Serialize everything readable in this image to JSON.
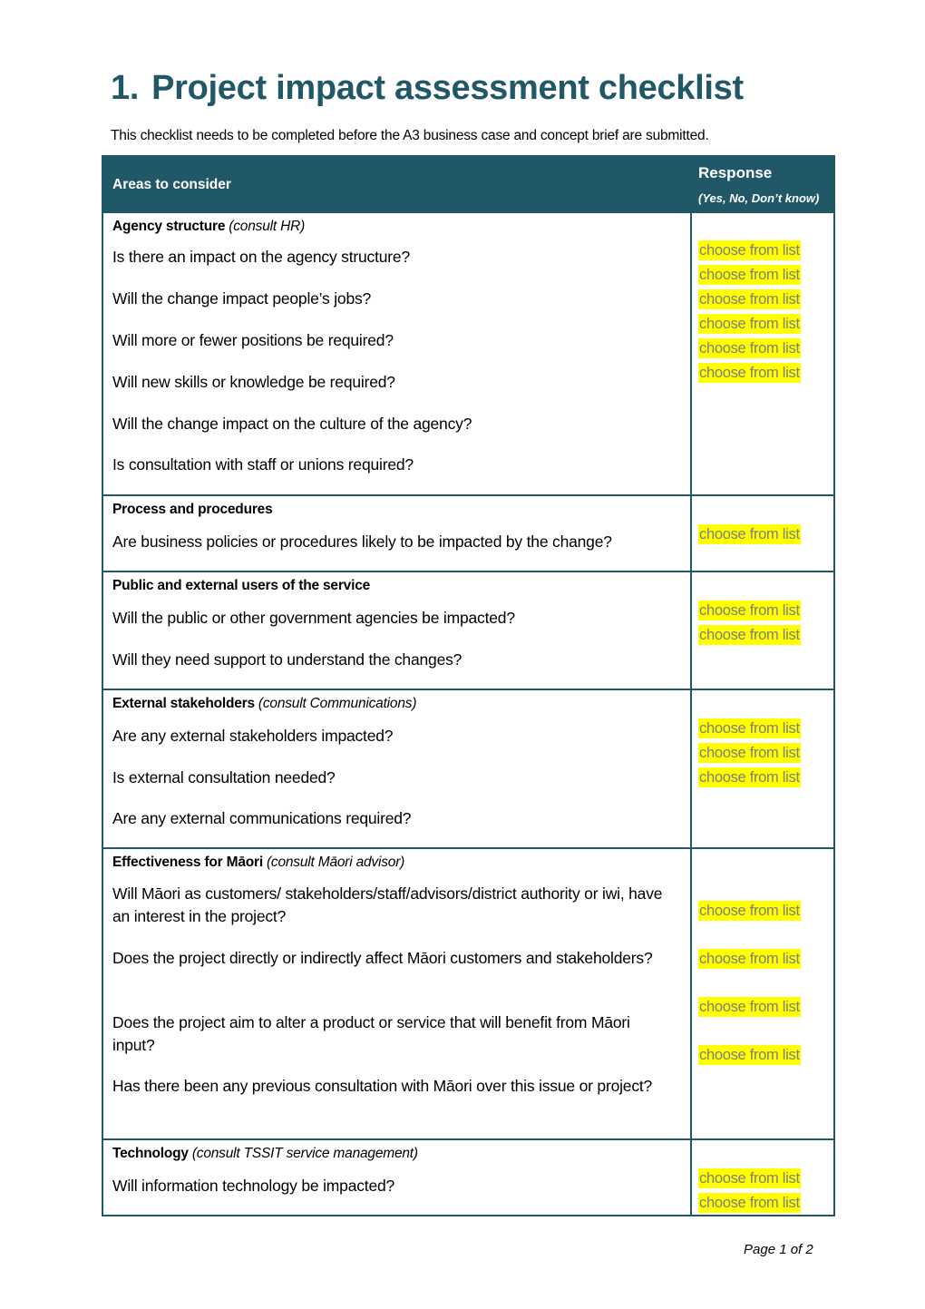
{
  "document": {
    "title_number": "1.",
    "title": "Project impact assessment checklist",
    "intro": "This checklist needs to be completed before the A3 business case and concept brief are submitted.",
    "footer": "Page 1 of 2"
  },
  "colors": {
    "brand": "#215868",
    "highlight": "#ffff00",
    "placeholder_text": "#7f7f7f"
  },
  "table": {
    "header": {
      "areas": "Areas to consider",
      "response": "Response",
      "response_sub": "(Yes, No, Don’t know)"
    },
    "sections": [
      {
        "title": "Agency structure",
        "consult": "(consult HR)",
        "questions": [
          "Is there an impact on the agency structure?",
          "Will the change impact people’s jobs?",
          "Will more or fewer positions be required?",
          "Will new skills or knowledge be required?",
          "Will the change impact on the culture of the agency?",
          "Is consultation with staff or unions required?"
        ],
        "responses": [
          "choose from list",
          "choose from list",
          "choose from list",
          "choose from list",
          "choose from list",
          "choose from list"
        ]
      },
      {
        "title": "Process and procedures",
        "consult": "",
        "questions": [
          "Are business policies or procedures likely to be impacted by the change?"
        ],
        "responses": [
          "choose from list"
        ]
      },
      {
        "title": "Public and external users of the service",
        "consult": "",
        "questions": [
          "Will the public or other government agencies be impacted?",
          "Will they need support to understand the changes?"
        ],
        "responses": [
          "choose from list",
          "choose from list"
        ]
      },
      {
        "title": "External stakeholders",
        "consult": "(consult Communications)",
        "questions": [
          "Are any external stakeholders impacted?",
          "Is external consultation needed?",
          "Are any external communications required?"
        ],
        "responses": [
          "choose from list",
          "choose from list",
          "choose from list"
        ]
      },
      {
        "title": "Effectiveness for Māori",
        "consult": "(consult Māori  advisor)",
        "questions": [
          "Will Māori as customers/ stakeholders/staff/advisors/district authority or iwi, have an interest in the project?",
          "Does the project directly or indirectly affect Māori customers and stakeholders?",
          "Does the project aim to alter a product or service that will benefit from Māori input?",
          "Has there been any previous consultation with Māori over this issue or project?"
        ],
        "responses": [
          "choose from list",
          "choose from list",
          "choose from list",
          "choose from list"
        ]
      },
      {
        "title": "Technology",
        "consult": "(consult TSSIT service management)",
        "questions": [
          "Will information technology be impacted?"
        ],
        "responses": [
          "choose from list",
          "choose from list"
        ]
      }
    ]
  }
}
